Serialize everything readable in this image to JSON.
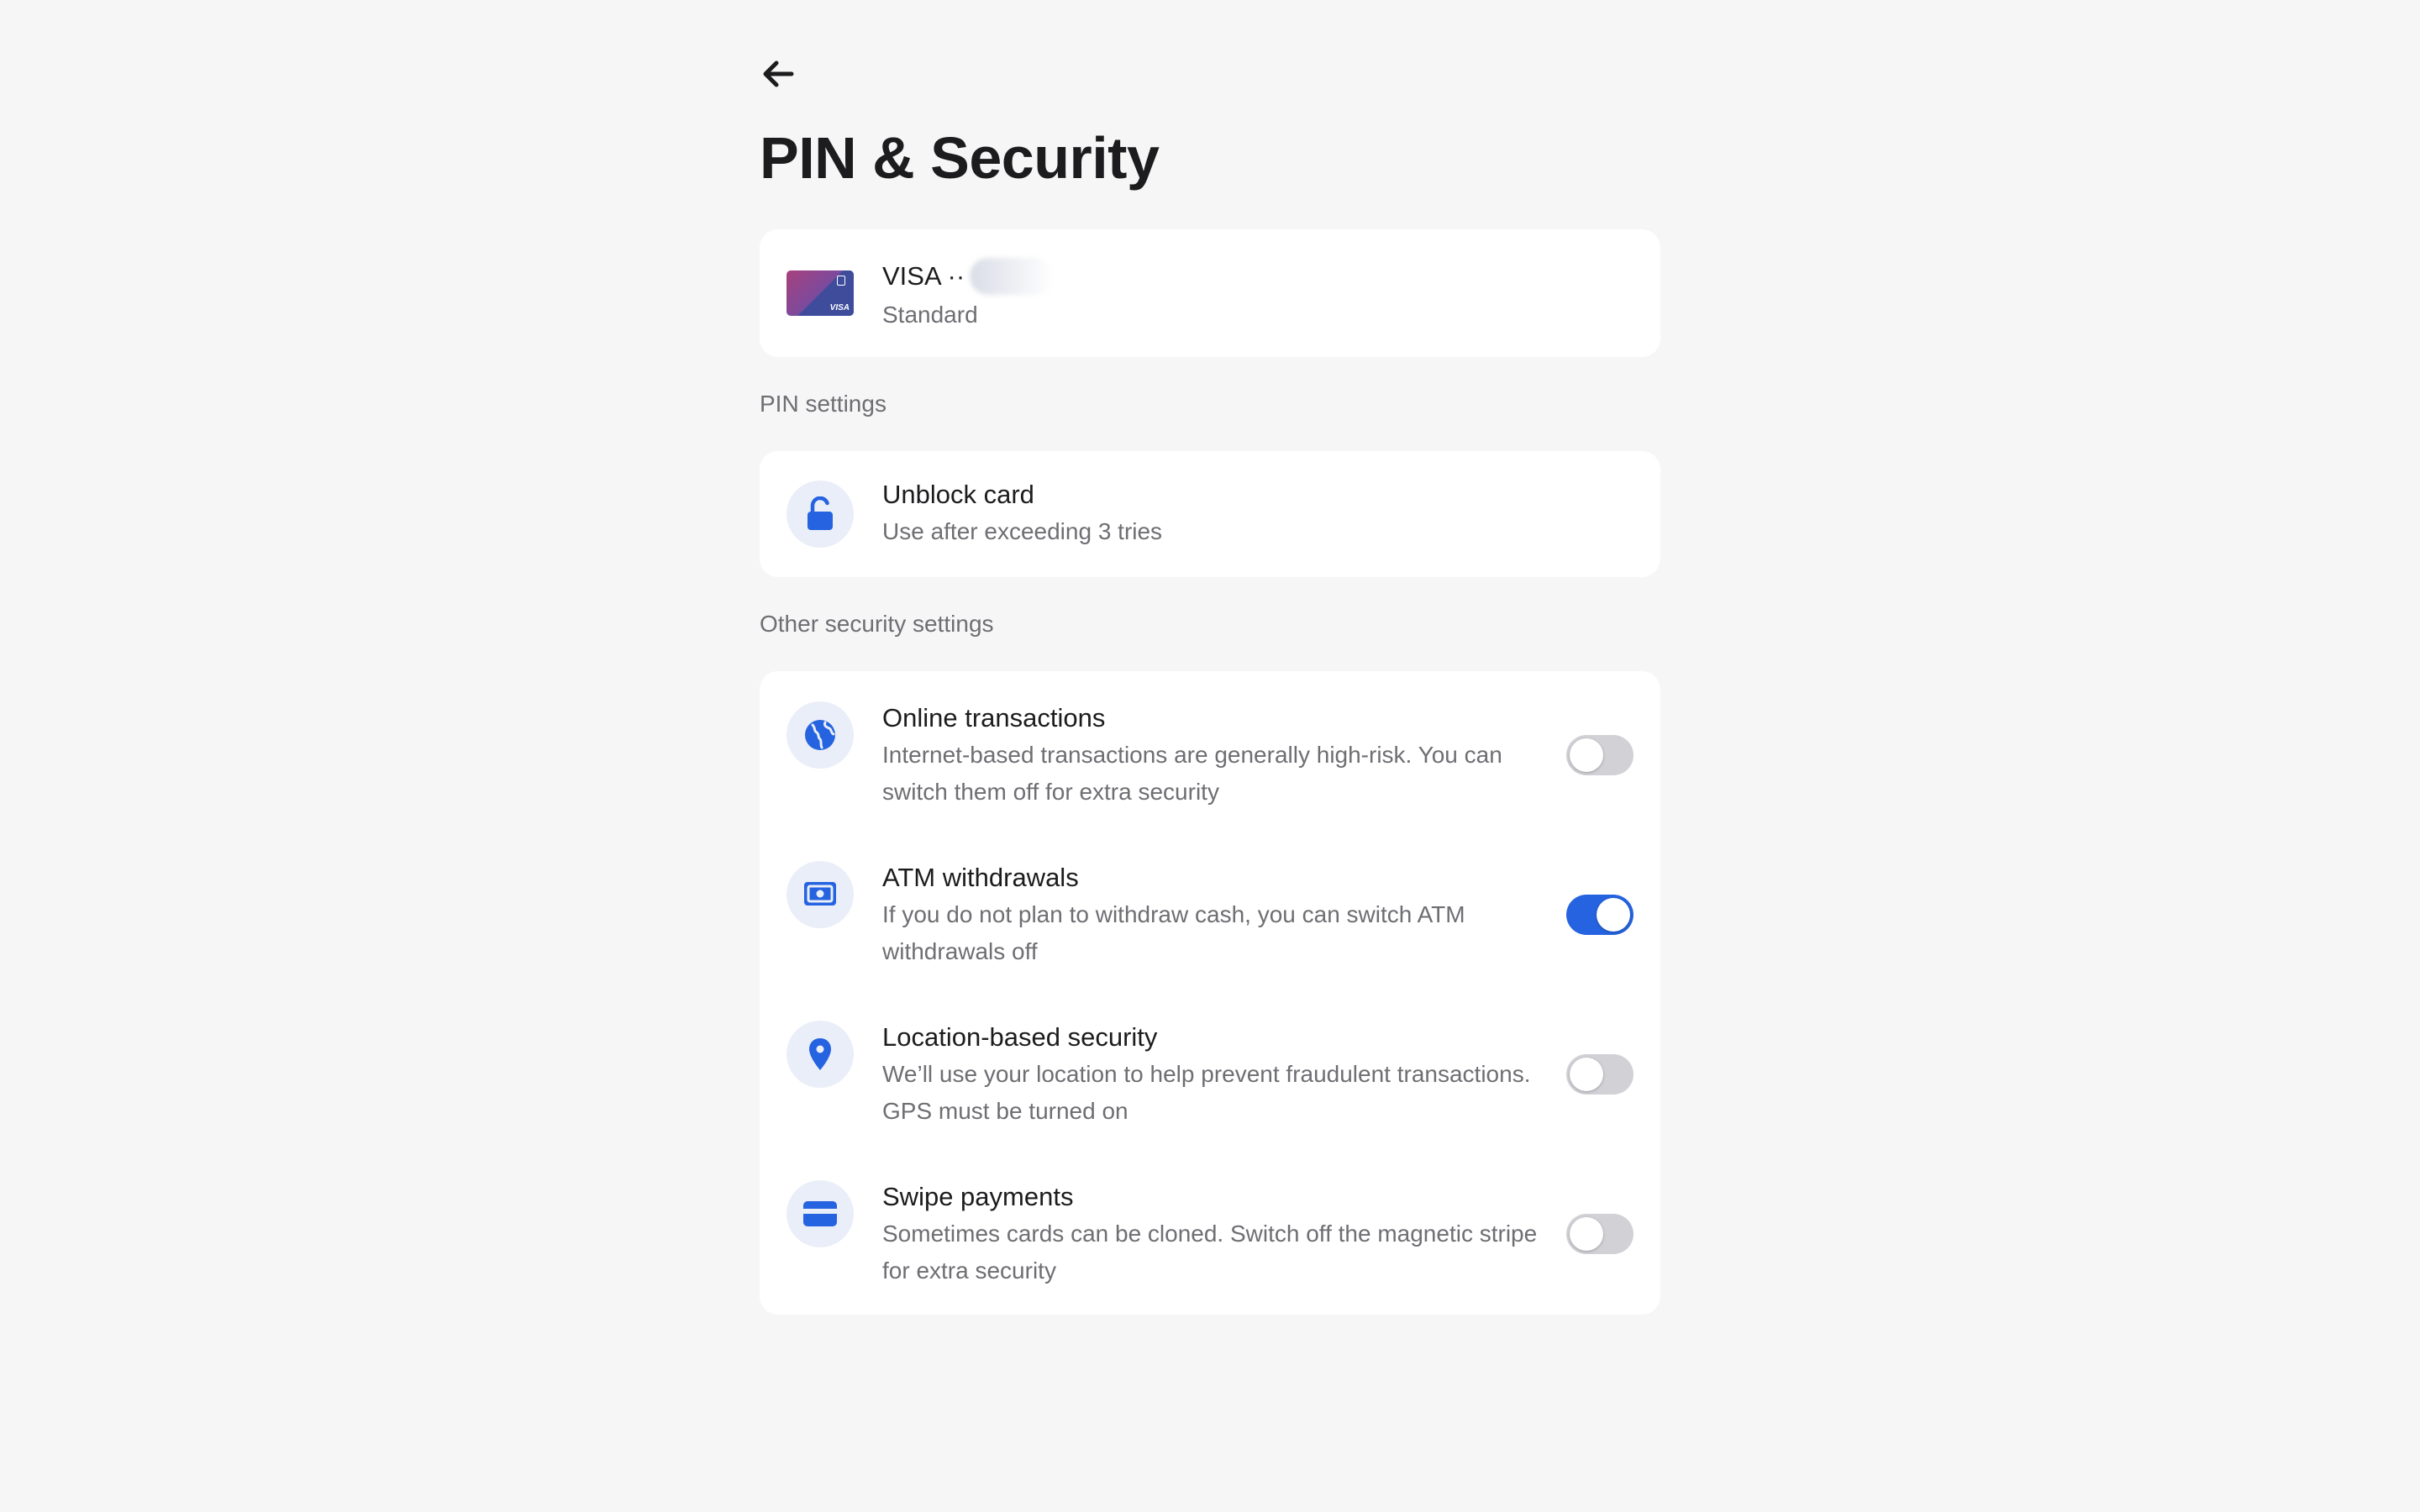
{
  "page": {
    "title": "PIN & Security",
    "back_icon": "arrow-left-icon"
  },
  "card": {
    "title": "VISA ··",
    "subtitle": "Standard",
    "thumb_brand": "VISA",
    "icon": "visa-card-thumbnail"
  },
  "pin_settings": {
    "label": "PIN settings",
    "items": [
      {
        "title": "Unblock card",
        "description": "Use after exceeding 3 tries",
        "icon": "unlock-icon"
      }
    ]
  },
  "other_settings": {
    "label": "Other security settings",
    "items": [
      {
        "title": "Online transactions",
        "description": "Internet-based transactions are generally high-risk. You can switch them off for extra security",
        "icon": "globe-icon",
        "enabled": false
      },
      {
        "title": "ATM withdrawals",
        "description": "If you do not plan to withdraw cash, you can switch ATM withdrawals off",
        "icon": "cash-icon",
        "enabled": true
      },
      {
        "title": "Location-based security",
        "description": "We’ll use your location to help prevent fraudulent transactions. GPS must be turned on",
        "icon": "location-pin-icon",
        "enabled": false
      },
      {
        "title": "Swipe payments",
        "description": "Sometimes cards can be cloned. Switch off the magnetic stripe for extra security",
        "icon": "credit-card-icon",
        "enabled": false
      }
    ]
  },
  "colors": {
    "background": "#f6f6f7",
    "accent": "#2563e0",
    "icon_bg": "#eaeef8",
    "toggle_off": "#d1d1d6",
    "secondary_text": "#6e6e73"
  }
}
